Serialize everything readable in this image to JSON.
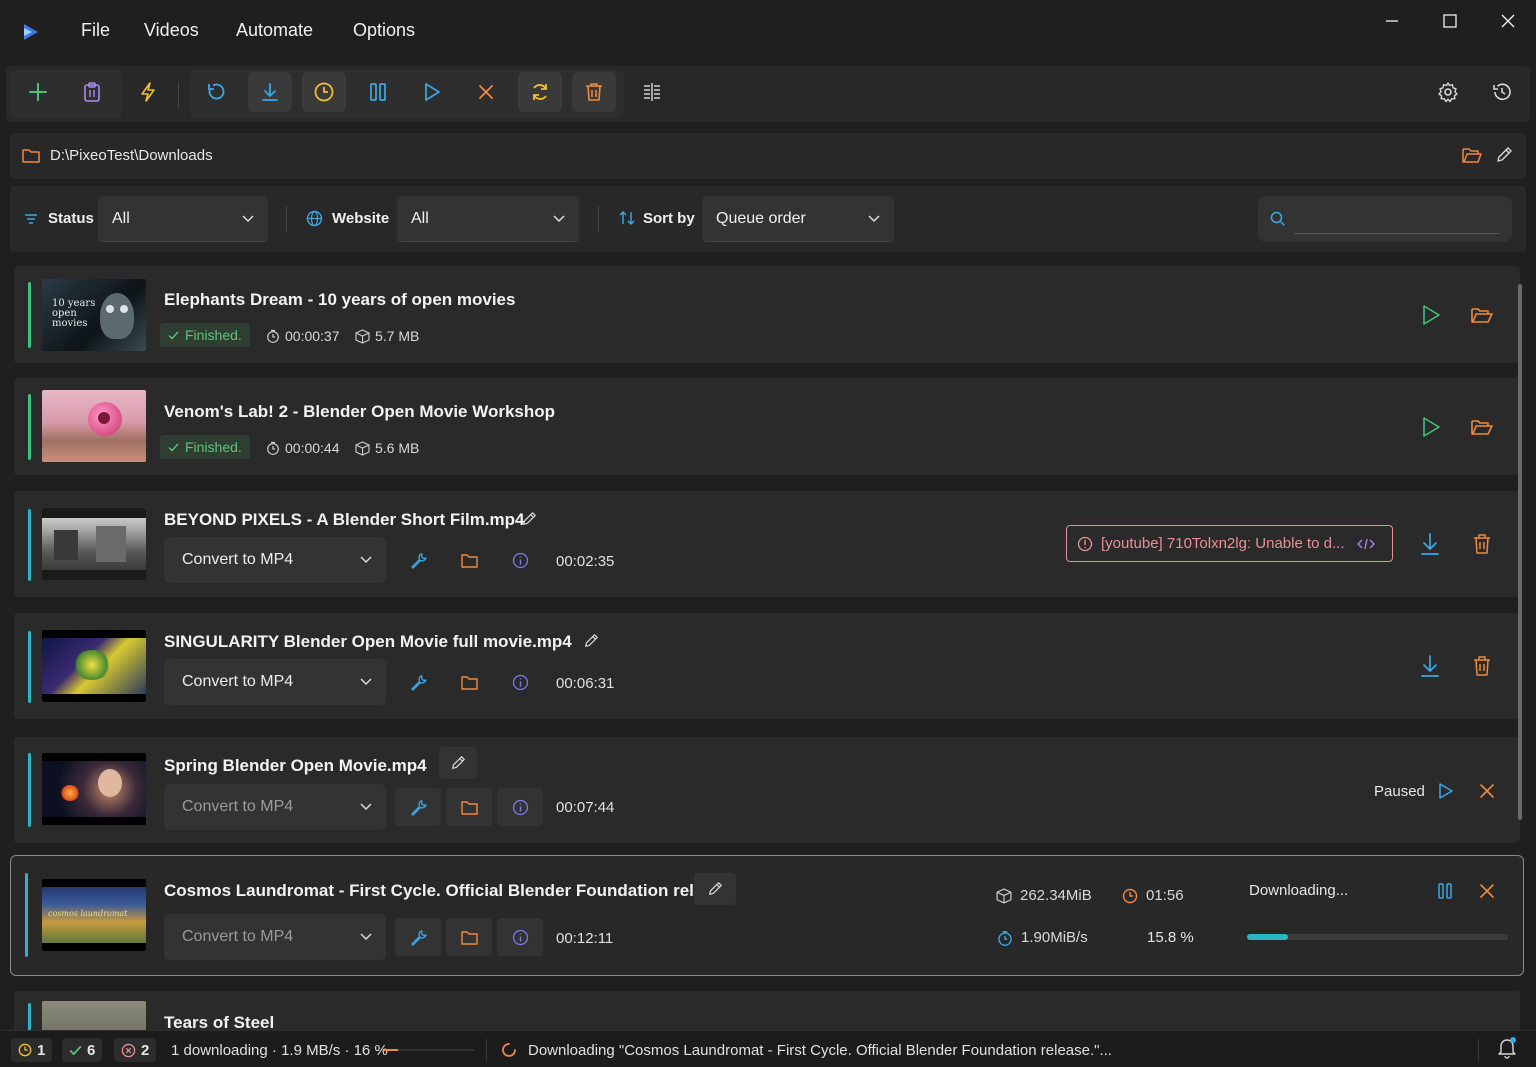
{
  "menu": {
    "file": "File",
    "videos": "Videos",
    "automate": "Automate",
    "options": "Options"
  },
  "path": "D:\\PixeoTest\\Downloads",
  "filters": {
    "status_label": "Status",
    "status_value": "All",
    "website_label": "Website",
    "website_value": "All",
    "sort_label": "Sort by",
    "sort_value": "Queue order",
    "search_placeholder": ""
  },
  "items": [
    {
      "title": "Elephants Dream - 10 years of open movies",
      "status": "Finished.",
      "duration": "00:00:37",
      "size": "5.7 MB",
      "thumb_text": "10 years open movies"
    },
    {
      "title": "Venom's Lab! 2 - Blender Open Movie Workshop",
      "status": "Finished.",
      "duration": "00:00:44",
      "size": "5.6 MB"
    },
    {
      "title": "BEYOND PIXELS - A Blender Short Film.mp4",
      "format": "Convert to MP4",
      "duration": "00:02:35",
      "error": "[youtube] 710Tolxn2lg: Unable to d..."
    },
    {
      "title": "SINGULARITY   Blender Open Movie full movie.mp4",
      "format": "Convert to MP4",
      "duration": "00:06:31"
    },
    {
      "title": "Spring   Blender Open Movie.mp4",
      "format": "Convert to MP4",
      "duration": "00:07:44",
      "status": "Paused"
    },
    {
      "title": "Cosmos Laundromat - First Cycle. Official Blender Foundation rele...",
      "format": "Convert to MP4",
      "duration": "00:12:11",
      "downloaded": "262.34MiB",
      "eta": "01:56",
      "speed": "1.90MiB/s",
      "percent": "15.8 %",
      "progress": 0.158,
      "status": "Downloading...",
      "thumb_text": "cosmos laundromat"
    },
    {
      "title": "Tears of Steel"
    }
  ],
  "statusbar": {
    "scheduled": "1",
    "finished": "6",
    "errors": "2",
    "summary": "1 downloading · 1.9 MB/s · 16 %",
    "message": "Downloading \"Cosmos Laundromat - First Cycle. Official Blender Foundation release.\"..."
  },
  "colors": {
    "accent_teal": "#2fb4c6",
    "green": "#4fc27a",
    "orange": "#f08a3c",
    "blue": "#3aa8e8",
    "red": "#e8909a",
    "purple": "#a68cf0",
    "yellow": "#f0c030"
  }
}
